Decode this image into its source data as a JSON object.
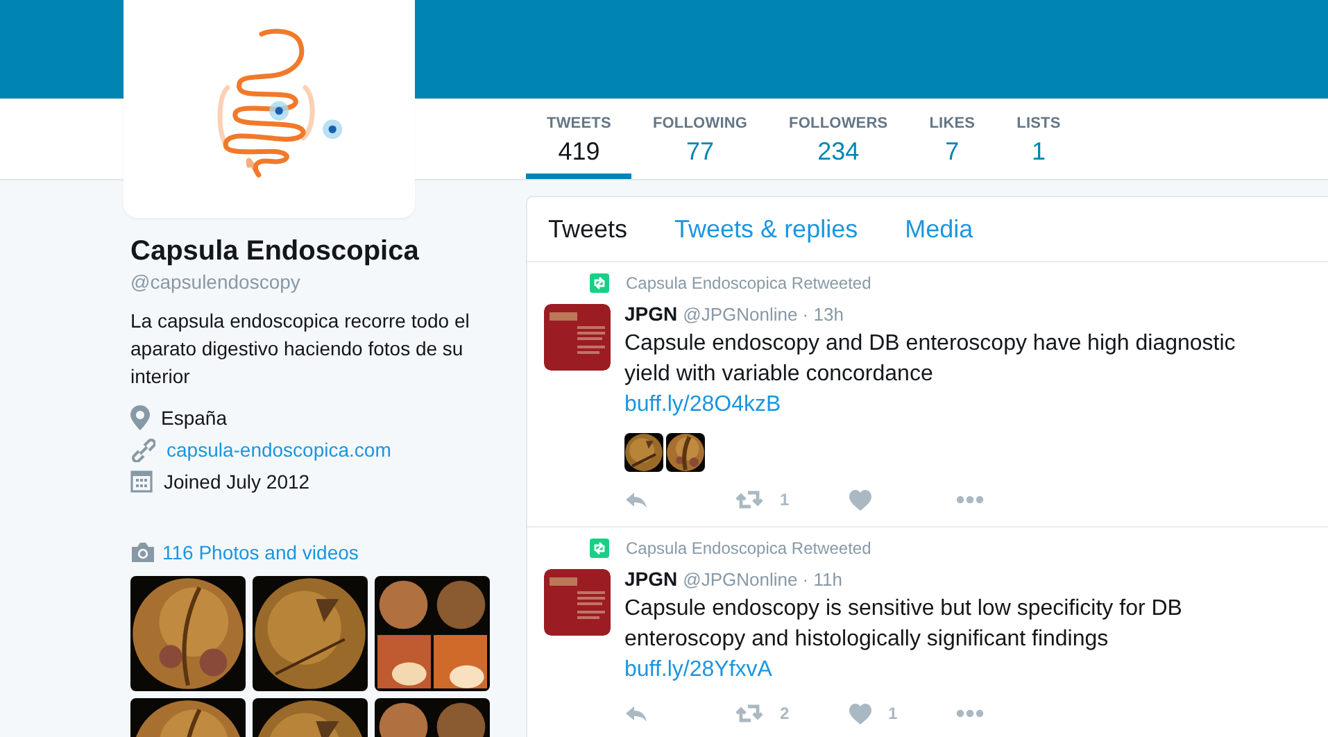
{
  "profile": {
    "name": "Capsula Endoscopica",
    "handle": "@capsulendoscopy",
    "bio": "La capsula endoscopica recorre todo el aparato digestivo haciendo fotos de su interior",
    "location": "España",
    "website": "capsula-endoscopica.com",
    "joined": "Joined July 2012",
    "photos_link": "116 Photos and videos"
  },
  "stats": [
    {
      "label": "TWEETS",
      "value": "419",
      "selected": true
    },
    {
      "label": "FOLLOWING",
      "value": "77",
      "selected": false
    },
    {
      "label": "FOLLOWERS",
      "value": "234",
      "selected": false
    },
    {
      "label": "LIKES",
      "value": "7",
      "selected": false
    },
    {
      "label": "LISTS",
      "value": "1",
      "selected": false
    }
  ],
  "timeline_tabs": [
    {
      "label": "Tweets",
      "selected": true
    },
    {
      "label": "Tweets & replies",
      "selected": false
    },
    {
      "label": "Media",
      "selected": false
    }
  ],
  "tweets": [
    {
      "context": "Capsula Endoscopica Retweeted",
      "author": "JPGN",
      "meta": "@JPGNonline · 13h",
      "text": "Capsule endoscopy and DB enteroscopy have high diagnostic yield with variable concordance",
      "link": "buff.ly/28O4kzB",
      "retweets": "1"
    },
    {
      "context": "Capsula Endoscopica Retweeted",
      "author": "JPGN",
      "meta": "@JPGNonline · 11h",
      "text": "Capsule endoscopy is sensitive but low specificity for DB enteroscopy and histologically significant findings",
      "link": "buff.ly/28YfxvA",
      "retweets": "2",
      "likes": "1"
    }
  ]
}
